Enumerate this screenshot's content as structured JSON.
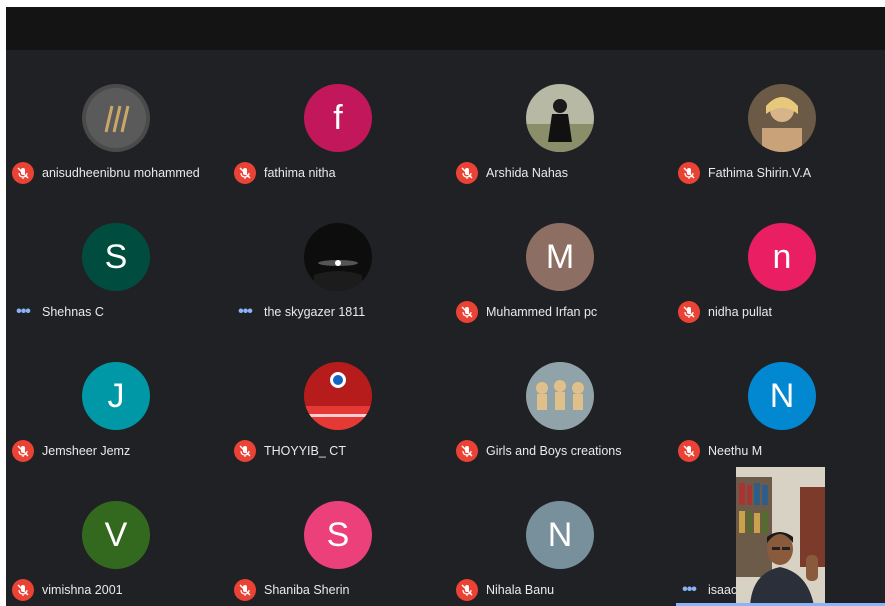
{
  "colors": {
    "mic_muted": "#ea4335",
    "background": "#202124",
    "topbar": "#141414",
    "activity": "#8ab4f8"
  },
  "participants": [
    {
      "name": "anisudheenibnu mohammed",
      "avatar_type": "logo-photo",
      "status": "muted"
    },
    {
      "name": "fathima nitha",
      "avatar_letter": "f",
      "avatar_color": "#c2185b",
      "status": "muted"
    },
    {
      "name": "Arshida Nahas",
      "avatar_type": "photo",
      "status": "muted"
    },
    {
      "name": "Fathima Shirin.V.A",
      "avatar_type": "photo",
      "status": "muted"
    },
    {
      "name": "Shehnas C",
      "avatar_letter": "S",
      "avatar_color": "#004d40",
      "status": "active"
    },
    {
      "name": "the skygazer 1811",
      "avatar_type": "photo",
      "status": "active"
    },
    {
      "name": "Muhammed Irfan pc",
      "avatar_letter": "M",
      "avatar_color": "#8d6e63",
      "status": "muted"
    },
    {
      "name": "nidha pullat",
      "avatar_letter": "n",
      "avatar_color": "#e91e63",
      "status": "muted"
    },
    {
      "name": "Jemsheer Jemz",
      "avatar_letter": "J",
      "avatar_color": "#0097a7",
      "status": "muted"
    },
    {
      "name": "THOYYIB_ CT",
      "avatar_type": "photo",
      "status": "muted"
    },
    {
      "name": "Girls and Boys creations",
      "avatar_type": "photo",
      "status": "muted"
    },
    {
      "name": "Neethu M",
      "avatar_letter": "N",
      "avatar_color": "#0288d1",
      "status": "muted"
    },
    {
      "name": "vimishna 2001",
      "avatar_letter": "V",
      "avatar_color": "#33691e",
      "status": "muted"
    },
    {
      "name": "Shaniba Sherin",
      "avatar_letter": "S",
      "avatar_color": "#ec407a",
      "status": "muted"
    },
    {
      "name": "Nihala Banu",
      "avatar_letter": "N",
      "avatar_color": "#78909c",
      "status": "muted"
    },
    {
      "name": "isaac thomas",
      "avatar_type": "video",
      "status": "active"
    }
  ],
  "indicator_icons": {
    "muted": "mic-off-icon",
    "active": "more-dots-icon"
  }
}
